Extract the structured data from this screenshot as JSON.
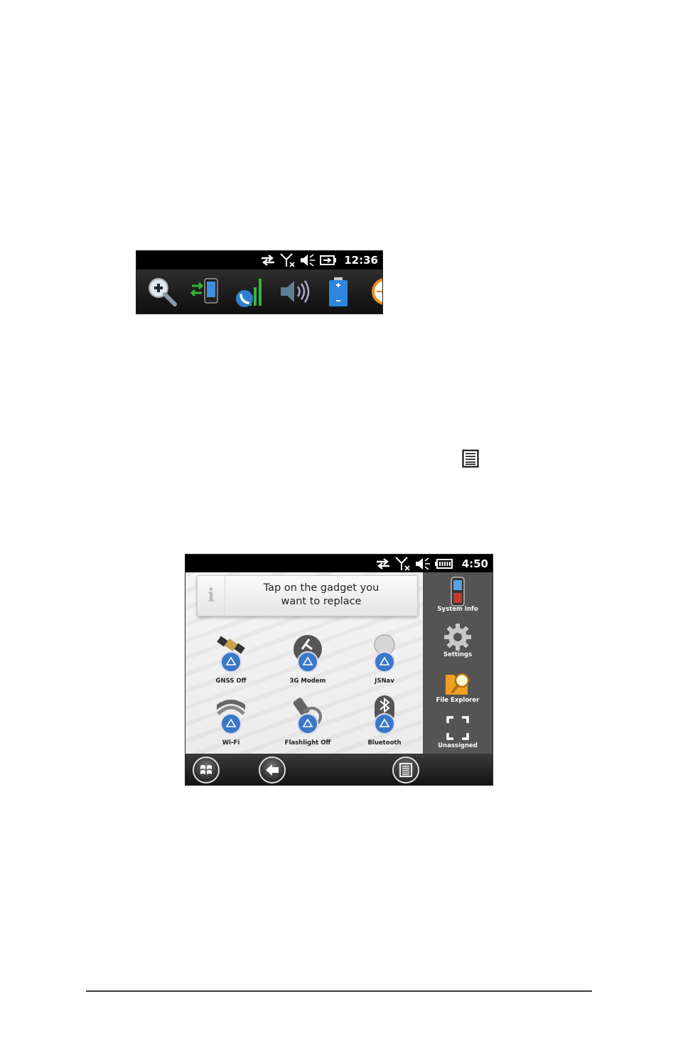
{
  "status_bar_top": {
    "time": "12:36",
    "icons": [
      "sync-arrows-icon",
      "no-signal-icon",
      "muted-speaker-icon",
      "battery-charging-icon"
    ]
  },
  "tray": {
    "icons": [
      "zoom-in-icon",
      "phone-sync-icon",
      "phone-signal-icon",
      "volume-icon",
      "battery-icon",
      "clock-icon"
    ]
  },
  "menu_glyph": {
    "icon": "menu-list-icon"
  },
  "device": {
    "status_bar": {
      "time": "4:50",
      "icons": [
        "sync-arrows-icon",
        "no-signal-icon",
        "muted-speaker-icon",
        "battery-full-icon"
      ]
    },
    "tooltip": {
      "line1": "Tap on the gadget you",
      "line2": "want to replace"
    },
    "gadgets": [
      {
        "label": "GNSS Off"
      },
      {
        "label": "3G Modem"
      },
      {
        "label": "JSNav"
      },
      {
        "label": "Wi-Fi"
      },
      {
        "label": "Flashlight Off"
      },
      {
        "label": "Bluetooth"
      }
    ],
    "sidebar": [
      {
        "label": "System Info"
      },
      {
        "label": "Settings"
      },
      {
        "label": "File Explorer"
      },
      {
        "label": "Unassigned"
      }
    ],
    "softkeys": [
      "start-button",
      "back-button",
      "menu-button"
    ],
    "colors": {
      "accent": "#3a78c8",
      "sidebar": "#545454",
      "statusbar": "#000000"
    }
  }
}
